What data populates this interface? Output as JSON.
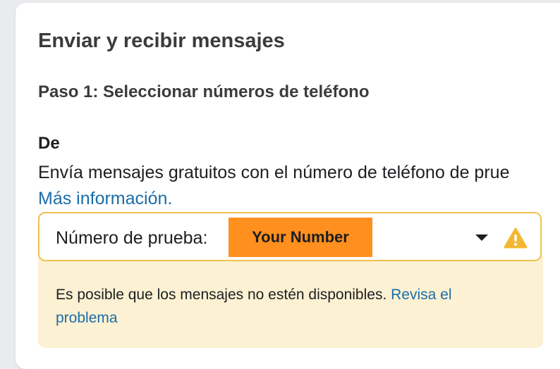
{
  "section": {
    "title": "Enviar y recibir mensajes",
    "step_title": "Paso 1: Seleccionar números de teléfono"
  },
  "from": {
    "label": "De",
    "description": "Envía mensajes gratuitos con el número de teléfono de prue",
    "more_info_link": "Más información."
  },
  "phone_select": {
    "label": "Número de prueba:",
    "selected_value": "Your Number",
    "dropdown_icon": "caret-down-icon",
    "status_icon": "warning-icon",
    "badge_color": "#ff8f1f",
    "border_color": "#f0c04f"
  },
  "alert": {
    "message": "Es posible que los mensajes no estén disponibles.",
    "link": "Revisa el problema",
    "background": "#fdf1d3",
    "warning_color": "#f5b731"
  }
}
